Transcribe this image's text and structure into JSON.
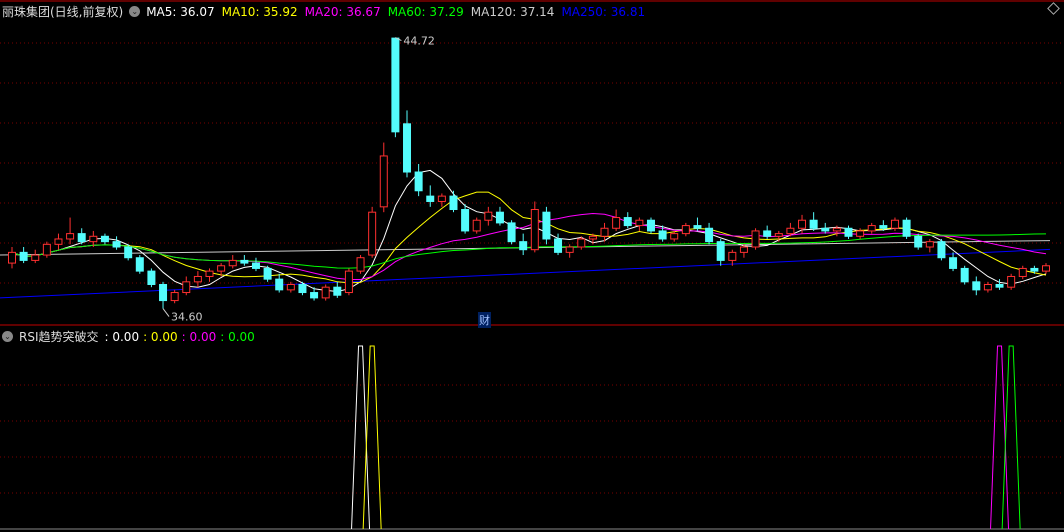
{
  "header": {
    "title": "丽珠集团(日线,前复权)",
    "mas": [
      {
        "label": "MA5: 36.07",
        "color": "#ffffff"
      },
      {
        "label": "MA10: 35.92",
        "color": "#ffff00"
      },
      {
        "label": "MA20: 36.67",
        "color": "#ff00ff"
      },
      {
        "label": "MA60: 37.29",
        "color": "#00ff00"
      },
      {
        "label": "MA120: 37.14",
        "color": "#cccccc"
      },
      {
        "label": "MA250: 36.81",
        "color": "#0000ff"
      }
    ]
  },
  "indicator": {
    "title": "RSI趋势突破交",
    "values": [
      {
        "label": ": 0.00",
        "color": "#ffffff"
      },
      {
        "label": ": 0.00",
        "color": "#ffff00"
      },
      {
        "label": ": 0.00",
        "color": "#ff00ff"
      },
      {
        "label": ": 0.00",
        "color": "#00ff00"
      }
    ]
  },
  "colors": {
    "up": "#ff3030",
    "down": "#54fcfc",
    "grid": "#7a0000",
    "border": "#c00000"
  },
  "finance_marker": "财",
  "chart_data": {
    "type": "candlestick",
    "price_range": [
      34.1,
      45.6
    ],
    "max_label": "44.72",
    "min_label": "34.60",
    "max_index": 33,
    "min_index": 13,
    "ohlc": [
      [
        36.3,
        36.9,
        36.1,
        36.7
      ],
      [
        36.7,
        36.9,
        36.3,
        36.4
      ],
      [
        36.4,
        36.8,
        36.3,
        36.6
      ],
      [
        36.6,
        37.1,
        36.5,
        37.0
      ],
      [
        37.0,
        37.4,
        36.8,
        37.2
      ],
      [
        37.2,
        38.0,
        37.0,
        37.4
      ],
      [
        37.4,
        37.6,
        37.0,
        37.1
      ],
      [
        37.1,
        37.5,
        36.9,
        37.3
      ],
      [
        37.3,
        37.4,
        37.0,
        37.1
      ],
      [
        37.1,
        37.3,
        36.8,
        36.9
      ],
      [
        36.9,
        37.0,
        36.4,
        36.5
      ],
      [
        36.5,
        36.6,
        35.9,
        36.0
      ],
      [
        36.0,
        36.1,
        35.4,
        35.5
      ],
      [
        35.5,
        35.6,
        34.6,
        34.9
      ],
      [
        34.9,
        35.3,
        34.8,
        35.2
      ],
      [
        35.2,
        35.8,
        35.1,
        35.6
      ],
      [
        35.6,
        36.0,
        35.4,
        35.8
      ],
      [
        35.8,
        36.1,
        35.6,
        36.0
      ],
      [
        36.0,
        36.3,
        35.8,
        36.2
      ],
      [
        36.2,
        36.6,
        36.1,
        36.4
      ],
      [
        36.4,
        36.6,
        36.2,
        36.3
      ],
      [
        36.3,
        36.5,
        36.0,
        36.1
      ],
      [
        36.1,
        36.2,
        35.6,
        35.7
      ],
      [
        35.7,
        35.9,
        35.2,
        35.3
      ],
      [
        35.3,
        35.6,
        35.2,
        35.5
      ],
      [
        35.5,
        35.6,
        35.1,
        35.2
      ],
      [
        35.2,
        35.4,
        34.9,
        35.0
      ],
      [
        35.0,
        35.5,
        34.9,
        35.4
      ],
      [
        35.4,
        35.6,
        35.0,
        35.1
      ],
      [
        35.2,
        36.1,
        35.1,
        36.0
      ],
      [
        36.0,
        36.6,
        35.9,
        36.5
      ],
      [
        36.6,
        38.4,
        36.5,
        38.2
      ],
      [
        38.4,
        40.8,
        38.2,
        40.3
      ],
      [
        44.7,
        44.72,
        41.0,
        41.2
      ],
      [
        41.5,
        42.0,
        39.5,
        39.7
      ],
      [
        39.7,
        40.0,
        38.8,
        39.0
      ],
      [
        38.8,
        39.2,
        38.4,
        38.6
      ],
      [
        38.6,
        38.9,
        38.4,
        38.8
      ],
      [
        38.8,
        39.0,
        38.2,
        38.3
      ],
      [
        38.3,
        38.5,
        37.4,
        37.5
      ],
      [
        37.5,
        38.0,
        37.4,
        37.9
      ],
      [
        37.9,
        38.4,
        37.7,
        38.2
      ],
      [
        38.2,
        38.4,
        37.7,
        37.8
      ],
      [
        37.8,
        37.9,
        37.0,
        37.1
      ],
      [
        37.1,
        37.4,
        36.6,
        36.8
      ],
      [
        36.8,
        38.6,
        36.7,
        38.3
      ],
      [
        38.2,
        38.4,
        37.0,
        37.2
      ],
      [
        37.2,
        37.4,
        36.6,
        36.7
      ],
      [
        36.7,
        37.0,
        36.5,
        36.9
      ],
      [
        36.9,
        37.3,
        36.8,
        37.2
      ],
      [
        37.2,
        37.4,
        37.0,
        37.3
      ],
      [
        37.3,
        37.8,
        37.1,
        37.6
      ],
      [
        37.6,
        38.3,
        37.5,
        38.0
      ],
      [
        38.0,
        38.2,
        37.6,
        37.7
      ],
      [
        37.7,
        38.0,
        37.5,
        37.9
      ],
      [
        37.9,
        38.0,
        37.4,
        37.5
      ],
      [
        37.5,
        37.7,
        37.1,
        37.2
      ],
      [
        37.2,
        37.5,
        37.1,
        37.4
      ],
      [
        37.4,
        37.8,
        37.3,
        37.7
      ],
      [
        37.7,
        38.0,
        37.5,
        37.6
      ],
      [
        37.6,
        37.8,
        37.0,
        37.1
      ],
      [
        37.1,
        37.2,
        36.2,
        36.4
      ],
      [
        36.4,
        36.8,
        36.2,
        36.7
      ],
      [
        36.7,
        37.0,
        36.5,
        36.9
      ],
      [
        36.9,
        37.6,
        36.8,
        37.5
      ],
      [
        37.5,
        37.7,
        37.2,
        37.3
      ],
      [
        37.3,
        37.5,
        37.1,
        37.4
      ],
      [
        37.4,
        37.8,
        37.3,
        37.6
      ],
      [
        37.6,
        38.1,
        37.4,
        37.9
      ],
      [
        37.9,
        38.2,
        37.5,
        37.6
      ],
      [
        37.6,
        37.8,
        37.4,
        37.5
      ],
      [
        37.5,
        37.7,
        37.3,
        37.6
      ],
      [
        37.6,
        37.7,
        37.2,
        37.3
      ],
      [
        37.3,
        37.6,
        37.2,
        37.5
      ],
      [
        37.5,
        37.8,
        37.4,
        37.7
      ],
      [
        37.7,
        37.9,
        37.5,
        37.6
      ],
      [
        37.6,
        38.0,
        37.5,
        37.9
      ],
      [
        37.9,
        38.0,
        37.2,
        37.3
      ],
      [
        37.3,
        37.4,
        36.8,
        36.9
      ],
      [
        36.9,
        37.2,
        36.7,
        37.1
      ],
      [
        37.1,
        37.2,
        36.4,
        36.5
      ],
      [
        36.5,
        36.7,
        36.0,
        36.1
      ],
      [
        36.1,
        36.2,
        35.5,
        35.6
      ],
      [
        35.6,
        35.8,
        35.1,
        35.3
      ],
      [
        35.3,
        35.6,
        35.2,
        35.5
      ],
      [
        35.5,
        35.7,
        35.3,
        35.4
      ],
      [
        35.4,
        35.9,
        35.3,
        35.8
      ],
      [
        35.8,
        36.2,
        35.7,
        36.1
      ],
      [
        36.1,
        36.2,
        35.9,
        36.0
      ],
      [
        36.0,
        36.3,
        35.9,
        36.2
      ]
    ],
    "ma_periods": [
      {
        "period": 5,
        "color": "#ffffff"
      },
      {
        "period": 10,
        "color": "#ffff00"
      },
      {
        "period": 20,
        "color": "#ff00ff"
      },
      {
        "period": 60,
        "color": "#00ff00"
      }
    ],
    "long_mas": [
      {
        "name": "MA120",
        "color": "#cccccc",
        "start": 36.6,
        "end": 37.14
      },
      {
        "name": "MA250",
        "color": "#0000ff",
        "start": 35.0,
        "end": 36.81
      }
    ],
    "finance_marker_index": 42,
    "indicator_range": [
      0,
      100
    ],
    "signals": [
      {
        "color": "#ffffff",
        "index": 30
      },
      {
        "color": "#ffff00",
        "index": 31
      },
      {
        "color": "#ff00ff",
        "index": 85
      },
      {
        "color": "#00ff00",
        "index": 86
      }
    ]
  }
}
